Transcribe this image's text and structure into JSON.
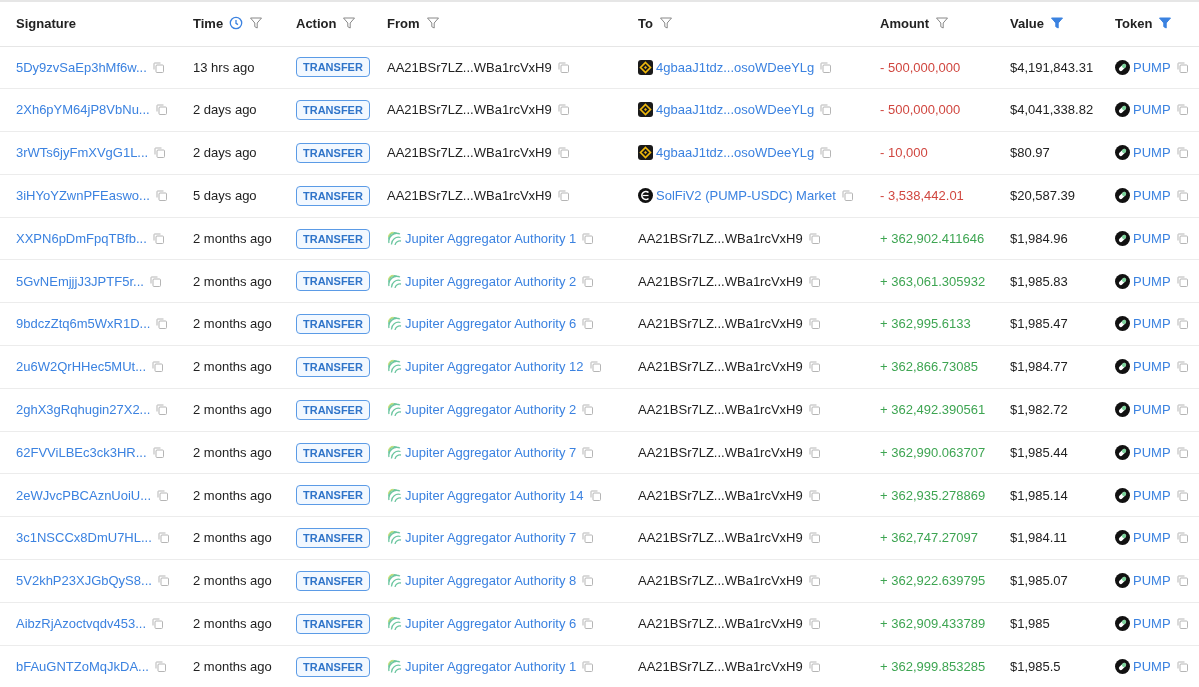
{
  "table": {
    "columns": [
      {
        "label": "Signature"
      },
      {
        "label": "Time",
        "clock": true,
        "filter": true,
        "filter_active": false
      },
      {
        "label": "Action",
        "filter": true,
        "filter_active": false
      },
      {
        "label": "From",
        "filter": true,
        "filter_active": false
      },
      {
        "label": "To",
        "filter": true,
        "filter_active": false
      },
      {
        "label": "Amount",
        "filter": true,
        "filter_active": false
      },
      {
        "label": "Value",
        "filter": true,
        "filter_active": true
      },
      {
        "label": "Token",
        "filter": true,
        "filter_active": true
      }
    ],
    "rows": [
      {
        "signature": "5Dy9zvSaEp3hMf6w...",
        "time": "13 hrs ago",
        "action": "TRANSFER",
        "from": {
          "text": "AA21BSr7LZ...WBa1rcVxH9",
          "kind": "address"
        },
        "to": {
          "text": "4gbaaJ1tdz...osoWDeeYLg",
          "kind": "exchange"
        },
        "amount": {
          "text": "- 500,000,000",
          "color": "#d0463f"
        },
        "value": "$4,191,843.31",
        "token": "PUMP"
      },
      {
        "signature": "2Xh6pYM64jP8VbNu...",
        "time": "2 days ago",
        "action": "TRANSFER",
        "from": {
          "text": "AA21BSr7LZ...WBa1rcVxH9",
          "kind": "address"
        },
        "to": {
          "text": "4gbaaJ1tdz...osoWDeeYLg",
          "kind": "exchange"
        },
        "amount": {
          "text": "- 500,000,000",
          "color": "#d0463f"
        },
        "value": "$4,041,338.82",
        "token": "PUMP"
      },
      {
        "signature": "3rWTs6jyFmXVgG1L...",
        "time": "2 days ago",
        "action": "TRANSFER",
        "from": {
          "text": "AA21BSr7LZ...WBa1rcVxH9",
          "kind": "address"
        },
        "to": {
          "text": "4gbaaJ1tdz...osoWDeeYLg",
          "kind": "exchange"
        },
        "amount": {
          "text": "- 10,000",
          "color": "#d0463f"
        },
        "value": "$80.97",
        "token": "PUMP"
      },
      {
        "signature": "3iHYoYZwnPFEaswo...",
        "time": "5 days ago",
        "action": "TRANSFER",
        "from": {
          "text": "AA21BSr7LZ...WBa1rcVxH9",
          "kind": "address"
        },
        "to": {
          "text": "SolFiV2 (PUMP-USDC) Market",
          "kind": "market"
        },
        "amount": {
          "text": "- 3,538,442.01",
          "color": "#d0463f"
        },
        "value": "$20,587.39",
        "token": "PUMP"
      },
      {
        "signature": "XXPN6pDmFpqTBfb...",
        "time": "2 months ago",
        "action": "TRANSFER",
        "from": {
          "text": "Jupiter Aggregator Authority 1",
          "kind": "program"
        },
        "to": {
          "text": "AA21BSr7LZ...WBa1rcVxH9",
          "kind": "address"
        },
        "amount": {
          "text": "+ 362,902.411646",
          "color": "#3ea552"
        },
        "value": "$1,984.96",
        "token": "PUMP"
      },
      {
        "signature": "5GvNEmjjjJ3JPTF5r...",
        "time": "2 months ago",
        "action": "TRANSFER",
        "from": {
          "text": "Jupiter Aggregator Authority 2",
          "kind": "program"
        },
        "to": {
          "text": "AA21BSr7LZ...WBa1rcVxH9",
          "kind": "address"
        },
        "amount": {
          "text": "+ 363,061.305932",
          "color": "#3ea552"
        },
        "value": "$1,985.83",
        "token": "PUMP"
      },
      {
        "signature": "9bdczZtq6m5WxR1D...",
        "time": "2 months ago",
        "action": "TRANSFER",
        "from": {
          "text": "Jupiter Aggregator Authority 6",
          "kind": "program"
        },
        "to": {
          "text": "AA21BSr7LZ...WBa1rcVxH9",
          "kind": "address"
        },
        "amount": {
          "text": "+ 362,995.6133",
          "color": "#3ea552"
        },
        "value": "$1,985.47",
        "token": "PUMP"
      },
      {
        "signature": "2u6W2QrHHec5MUt...",
        "time": "2 months ago",
        "action": "TRANSFER",
        "from": {
          "text": "Jupiter Aggregator Authority 12",
          "kind": "program"
        },
        "to": {
          "text": "AA21BSr7LZ...WBa1rcVxH9",
          "kind": "address"
        },
        "amount": {
          "text": "+ 362,866.73085",
          "color": "#3ea552"
        },
        "value": "$1,984.77",
        "token": "PUMP"
      },
      {
        "signature": "2ghX3gRqhugin27X2...",
        "time": "2 months ago",
        "action": "TRANSFER",
        "from": {
          "text": "Jupiter Aggregator Authority 2",
          "kind": "program"
        },
        "to": {
          "text": "AA21BSr7LZ...WBa1rcVxH9",
          "kind": "address"
        },
        "amount": {
          "text": "+ 362,492.390561",
          "color": "#3ea552"
        },
        "value": "$1,982.72",
        "token": "PUMP"
      },
      {
        "signature": "62FVViLBEc3ck3HR...",
        "time": "2 months ago",
        "action": "TRANSFER",
        "from": {
          "text": "Jupiter Aggregator Authority 7",
          "kind": "program"
        },
        "to": {
          "text": "AA21BSr7LZ...WBa1rcVxH9",
          "kind": "address"
        },
        "amount": {
          "text": "+ 362,990.063707",
          "color": "#3ea552"
        },
        "value": "$1,985.44",
        "token": "PUMP"
      },
      {
        "signature": "2eWJvcPBCAznUoiU...",
        "time": "2 months ago",
        "action": "TRANSFER",
        "from": {
          "text": "Jupiter Aggregator Authority 14",
          "kind": "program"
        },
        "to": {
          "text": "AA21BSr7LZ...WBa1rcVxH9",
          "kind": "address"
        },
        "amount": {
          "text": "+ 362,935.278869",
          "color": "#3ea552"
        },
        "value": "$1,985.14",
        "token": "PUMP"
      },
      {
        "signature": "3c1NSCCx8DmU7HL...",
        "time": "2 months ago",
        "action": "TRANSFER",
        "from": {
          "text": "Jupiter Aggregator Authority 7",
          "kind": "program"
        },
        "to": {
          "text": "AA21BSr7LZ...WBa1rcVxH9",
          "kind": "address"
        },
        "amount": {
          "text": "+ 362,747.27097",
          "color": "#3ea552"
        },
        "value": "$1,984.11",
        "token": "PUMP"
      },
      {
        "signature": "5V2khP23XJGbQyS8...",
        "time": "2 months ago",
        "action": "TRANSFER",
        "from": {
          "text": "Jupiter Aggregator Authority 8",
          "kind": "program"
        },
        "to": {
          "text": "AA21BSr7LZ...WBa1rcVxH9",
          "kind": "address"
        },
        "amount": {
          "text": "+ 362,922.639795",
          "color": "#3ea552"
        },
        "value": "$1,985.07",
        "token": "PUMP"
      },
      {
        "signature": "AibzRjAzoctvqdv453...",
        "time": "2 months ago",
        "action": "TRANSFER",
        "from": {
          "text": "Jupiter Aggregator Authority 6",
          "kind": "program"
        },
        "to": {
          "text": "AA21BSr7LZ...WBa1rcVxH9",
          "kind": "address"
        },
        "amount": {
          "text": "+ 362,909.433789",
          "color": "#3ea552"
        },
        "value": "$1,985",
        "token": "PUMP"
      },
      {
        "signature": "bFAuGNTZoMqJkDA...",
        "time": "2 months ago",
        "action": "TRANSFER",
        "from": {
          "text": "Jupiter Aggregator Authority 1",
          "kind": "program"
        },
        "to": {
          "text": "AA21BSr7LZ...WBa1rcVxH9",
          "kind": "address"
        },
        "amount": {
          "text": "+ 362,999.853285",
          "color": "#3ea552"
        },
        "value": "$1,985.5",
        "token": "PUMP"
      }
    ]
  }
}
